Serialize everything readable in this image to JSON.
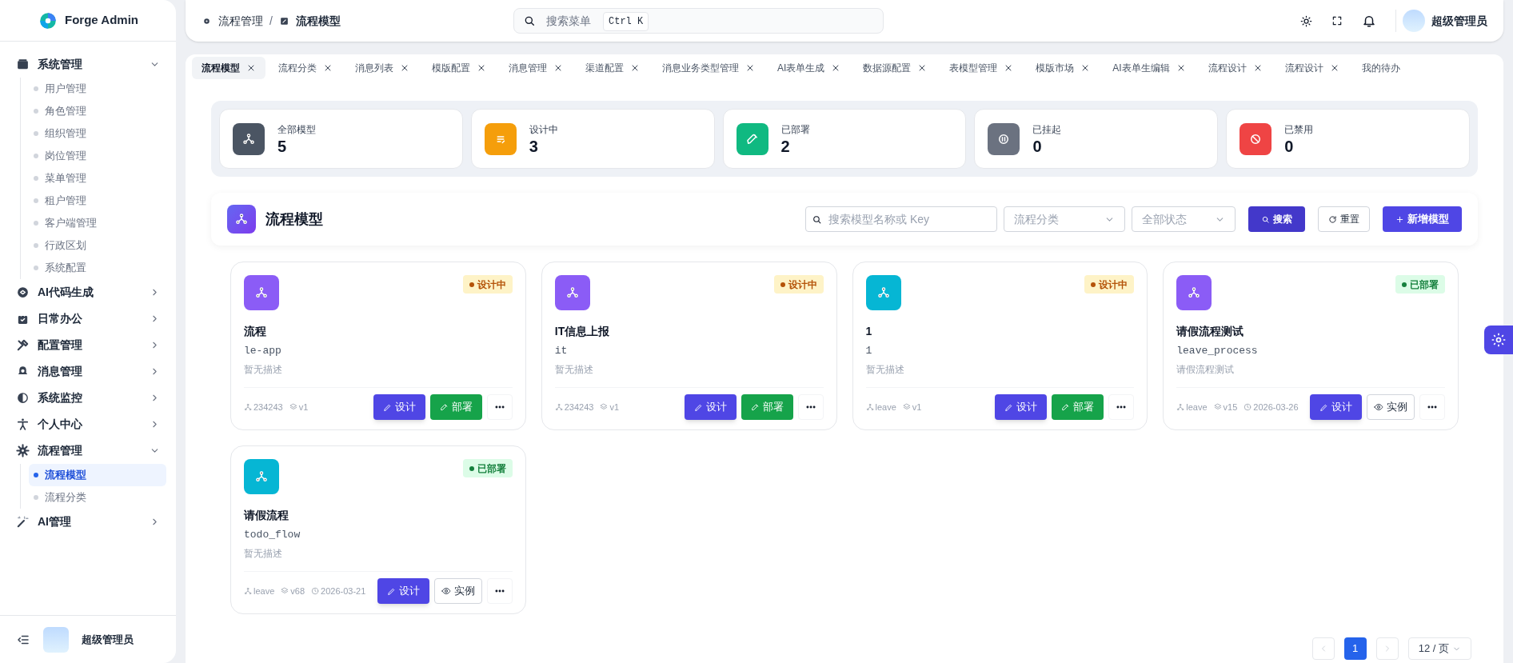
{
  "app": {
    "name": "Forge Admin"
  },
  "sidebar": {
    "items": [
      {
        "label": "系统管理",
        "expanded": true,
        "children": [
          {
            "label": "用户管理",
            "selected": false
          },
          {
            "label": "角色管理",
            "selected": false
          },
          {
            "label": "组织管理",
            "selected": false
          },
          {
            "label": "岗位管理",
            "selected": false
          },
          {
            "label": "菜单管理",
            "selected": false
          },
          {
            "label": "租户管理",
            "selected": false
          },
          {
            "label": "客户端管理",
            "selected": false
          },
          {
            "label": "行政区划",
            "selected": false
          },
          {
            "label": "系统配置",
            "selected": false
          }
        ]
      },
      {
        "label": "AI代码生成",
        "expanded": false
      },
      {
        "label": "日常办公",
        "expanded": false
      },
      {
        "label": "配置管理",
        "expanded": false
      },
      {
        "label": "消息管理",
        "expanded": false
      },
      {
        "label": "系统监控",
        "expanded": false
      },
      {
        "label": "个人中心",
        "expanded": false
      },
      {
        "label": "流程管理",
        "expanded": true,
        "children": [
          {
            "label": "流程模型",
            "selected": true
          },
          {
            "label": "流程分类",
            "selected": false
          }
        ]
      },
      {
        "label": "AI管理",
        "expanded": false
      }
    ],
    "user": "超级管理员"
  },
  "header": {
    "breadcrumb": [
      "流程管理",
      "/",
      "流程模型"
    ],
    "search": {
      "placeholder": "搜索菜单",
      "shortcut": "Ctrl K"
    },
    "user": "超级管理员"
  },
  "tabs": [
    {
      "label": "流程模型",
      "selected": true
    },
    {
      "label": "流程分类",
      "selected": false
    },
    {
      "label": "消息列表",
      "selected": false
    },
    {
      "label": "模版配置",
      "selected": false
    },
    {
      "label": "消息管理",
      "selected": false
    },
    {
      "label": "渠道配置",
      "selected": false
    },
    {
      "label": "消息业务类型管理",
      "selected": false
    },
    {
      "label": "AI表单生成",
      "selected": false
    },
    {
      "label": "数据源配置",
      "selected": false
    },
    {
      "label": "表模型管理",
      "selected": false
    },
    {
      "label": "模版市场",
      "selected": false
    },
    {
      "label": "AI表单生编辑",
      "selected": false
    },
    {
      "label": "流程设计",
      "selected": false
    },
    {
      "label": "流程设计",
      "selected": false
    },
    {
      "label": "我的待办",
      "selected": false
    }
  ],
  "stats": [
    {
      "label": "全部模型",
      "value": "5",
      "color": "#4b5563"
    },
    {
      "label": "设计中",
      "value": "3",
      "color": "#f59e0b"
    },
    {
      "label": "已部署",
      "value": "2",
      "color": "#10b981"
    },
    {
      "label": "已挂起",
      "value": "0",
      "color": "#6b7280"
    },
    {
      "label": "已禁用",
      "value": "0",
      "color": "#ef4444"
    }
  ],
  "toolbar": {
    "title": "流程模型",
    "search_placeholder": "搜索模型名称或 Key",
    "category_placeholder": "流程分类",
    "status_placeholder": "全部状态",
    "buttons": [
      "搜索",
      "重置",
      "新增模型"
    ]
  },
  "models": [
    {
      "name": "流程",
      "key": "le-app",
      "description": "暂无描述",
      "color": "#8b5cf6",
      "status": {
        "kind": "designing",
        "label": "设计中"
      },
      "meta": [
        {
          "kind": "category",
          "text": "234243"
        },
        {
          "kind": "version",
          "text": "v1"
        }
      ],
      "actions": [
        {
          "kind": "design",
          "label": "设计"
        },
        {
          "kind": "deploy",
          "label": "部署"
        }
      ]
    },
    {
      "name": "IT信息上报",
      "key": "it",
      "description": "暂无描述",
      "color": "#8b5cf6",
      "status": {
        "kind": "designing",
        "label": "设计中"
      },
      "meta": [
        {
          "kind": "category",
          "text": "234243"
        },
        {
          "kind": "version",
          "text": "v1"
        }
      ],
      "actions": [
        {
          "kind": "design",
          "label": "设计"
        },
        {
          "kind": "deploy",
          "label": "部署"
        }
      ]
    },
    {
      "name": "1",
      "key": "1",
      "description": "暂无描述",
      "color": "#06b6d4",
      "status": {
        "kind": "designing",
        "label": "设计中"
      },
      "meta": [
        {
          "kind": "category",
          "text": "leave"
        },
        {
          "kind": "version",
          "text": "v1"
        }
      ],
      "actions": [
        {
          "kind": "design",
          "label": "设计"
        },
        {
          "kind": "deploy",
          "label": "部署"
        }
      ]
    },
    {
      "name": "请假流程测试",
      "key": "leave_process",
      "description": "请假流程测试",
      "color": "#8b5cf6",
      "status": {
        "kind": "deployed",
        "label": "已部署"
      },
      "meta": [
        {
          "kind": "category",
          "text": "leave"
        },
        {
          "kind": "version",
          "text": "v15"
        },
        {
          "kind": "date",
          "text": "2026-03-26"
        }
      ],
      "actions": [
        {
          "kind": "design",
          "label": "设计"
        },
        {
          "kind": "instances",
          "label": "实例"
        }
      ]
    },
    {
      "name": "请假流程",
      "key": "todo_flow",
      "description": "暂无描述",
      "color": "#06b6d4",
      "status": {
        "kind": "deployed",
        "label": "已部署"
      },
      "meta": [
        {
          "kind": "category",
          "text": "leave"
        },
        {
          "kind": "version",
          "text": "v68"
        },
        {
          "kind": "date",
          "text": "2026-03-21"
        }
      ],
      "actions": [
        {
          "kind": "design",
          "label": "设计"
        },
        {
          "kind": "instances",
          "label": "实例"
        }
      ]
    }
  ],
  "pagination": {
    "pages": [
      {
        "label": "1",
        "selected": true
      }
    ],
    "page_size": "12 / 页"
  }
}
